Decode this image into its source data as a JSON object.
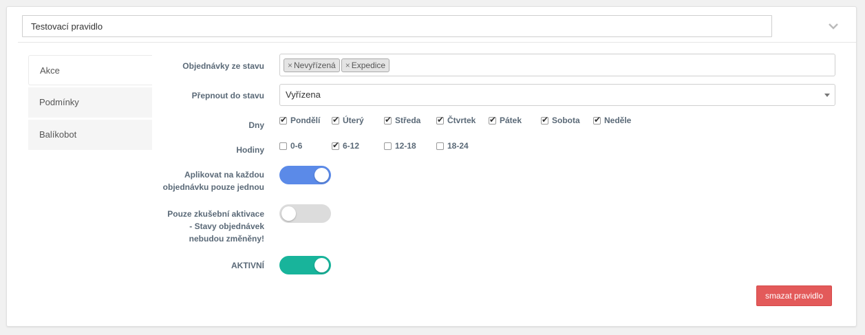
{
  "rule": {
    "name": "Testovací pravidlo"
  },
  "icons": {
    "collapse": "chevron-down-icon",
    "tag_remove": "×"
  },
  "tabs": [
    {
      "label": "Akce",
      "active": true
    },
    {
      "label": "Podmínky",
      "active": false
    },
    {
      "label": "Balíkobot",
      "active": false
    }
  ],
  "form": {
    "from_status": {
      "label": "Objednávky ze stavu",
      "tags": [
        "Nevyřízená",
        "Expedice"
      ]
    },
    "to_status": {
      "label": "Přepnout do stavu",
      "value": "Vyřízena"
    },
    "days": {
      "label": "Dny",
      "options": [
        {
          "label": "Pondělí",
          "checked": true
        },
        {
          "label": "Úterý",
          "checked": true
        },
        {
          "label": "Středa",
          "checked": true
        },
        {
          "label": "Čtvrtek",
          "checked": true
        },
        {
          "label": "Pátek",
          "checked": true
        },
        {
          "label": "Sobota",
          "checked": true
        },
        {
          "label": "Neděle",
          "checked": true
        }
      ]
    },
    "hours": {
      "label": "Hodiny",
      "options": [
        {
          "label": "0-6",
          "checked": false
        },
        {
          "label": "6-12",
          "checked": true
        },
        {
          "label": "12-18",
          "checked": false
        },
        {
          "label": "18-24",
          "checked": false
        }
      ]
    },
    "apply_once": {
      "label_line1": "Aplikovat na každou",
      "label_line2": "objednávku pouze jednou",
      "on": true,
      "color": "#5b8ae8"
    },
    "test_only": {
      "label_line1": "Pouze zkušební aktivace",
      "label_line2": "- Stavy objednávek",
      "label_line3": "nebudou změněny!",
      "on": false
    },
    "active": {
      "label": "AKTIVNÍ",
      "on": true,
      "color": "#18b49b"
    }
  },
  "actions": {
    "delete_label": "smazat pravidlo",
    "delete_color": "#e35a5a"
  }
}
